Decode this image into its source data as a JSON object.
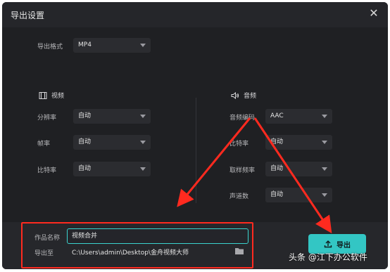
{
  "dialog": {
    "title": "导出设置",
    "close_icon": "close-icon"
  },
  "format": {
    "label": "导出格式",
    "value": "MP4"
  },
  "video": {
    "section_label": "视频",
    "icon": "film-icon",
    "resolution_label": "分辨率",
    "resolution_value": "自动",
    "framerate_label": "帧率",
    "framerate_value": "自动",
    "bitrate_label": "比特率",
    "bitrate_value": "自动"
  },
  "audio": {
    "section_label": "音频",
    "icon": "speaker-icon",
    "codec_label": "音频编码",
    "codec_value": "AAC",
    "bitrate_label": "比特率",
    "bitrate_value": "自动",
    "samplerate_label": "取样频率",
    "samplerate_value": "自动",
    "channels_label": "声道数",
    "channels_value": "自动"
  },
  "output": {
    "name_label": "作品名称",
    "name_value": "视频合并",
    "path_label": "导出至",
    "path_value": "C:\\Users\\admin\\Desktop\\金舟视频大师",
    "folder_icon": "folder-icon",
    "export_label": "导出",
    "export_icon": "upload-icon"
  },
  "annotations": {
    "highlight_color": "#ff2a1f"
  },
  "watermark": "头条 @江下办公软件",
  "colors": {
    "accent": "#33c6c4",
    "background": "#1f2023"
  }
}
